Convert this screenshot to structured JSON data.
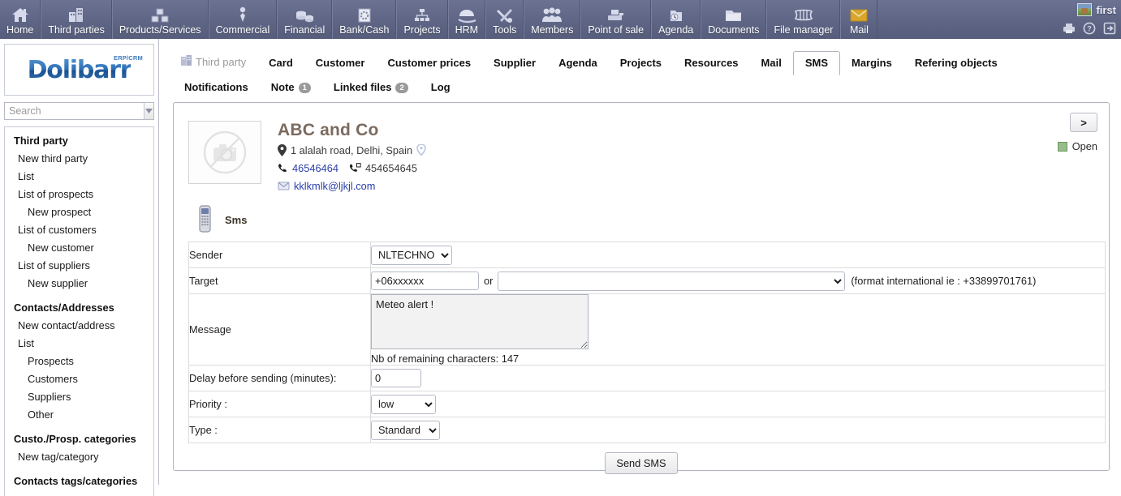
{
  "topmenu": {
    "items": [
      {
        "label": "Home",
        "icon": "home-icon"
      },
      {
        "label": "Third parties",
        "icon": "building-icon"
      },
      {
        "label": "Products/Services",
        "icon": "boxes-icon"
      },
      {
        "label": "Commercial",
        "icon": "tie-icon"
      },
      {
        "label": "Financial",
        "icon": "coins-icon"
      },
      {
        "label": "Bank/Cash",
        "icon": "bank-icon"
      },
      {
        "label": "Projects",
        "icon": "sitemap-icon"
      },
      {
        "label": "HRM",
        "icon": "umbrella-icon"
      },
      {
        "label": "Tools",
        "icon": "tools-icon"
      },
      {
        "label": "Members",
        "icon": "members-icon"
      },
      {
        "label": "Point of sale",
        "icon": "cash-register-icon"
      },
      {
        "label": "Agenda",
        "icon": "clock-folder-icon"
      },
      {
        "label": "Documents",
        "icon": "folder-icon"
      },
      {
        "label": "File manager",
        "icon": "filemanager-icon"
      },
      {
        "label": "Mail",
        "icon": "envelope-icon"
      }
    ],
    "user_name": "first",
    "right_icons": [
      "printer-icon",
      "help-icon",
      "logout-icon"
    ]
  },
  "sidebar": {
    "logo_text": "Dolibarr",
    "logo_sup": "ERP/CRM",
    "search": {
      "placeholder": "Search",
      "value": ""
    },
    "groups": [
      {
        "head": "Third party",
        "items": [
          {
            "label": "New third party",
            "level": 1
          },
          {
            "label": "List",
            "level": 1
          },
          {
            "label": "List of prospects",
            "level": 1
          },
          {
            "label": "New prospect",
            "level": 2
          },
          {
            "label": "List of customers",
            "level": 1
          },
          {
            "label": "New customer",
            "level": 2
          },
          {
            "label": "List of suppliers",
            "level": 1
          },
          {
            "label": "New supplier",
            "level": 2
          }
        ]
      },
      {
        "head": "Contacts/Addresses",
        "items": [
          {
            "label": "New contact/address",
            "level": 1
          },
          {
            "label": "List",
            "level": 1
          },
          {
            "label": "Prospects",
            "level": 2
          },
          {
            "label": "Customers",
            "level": 2
          },
          {
            "label": "Suppliers",
            "level": 2
          },
          {
            "label": "Other",
            "level": 2
          }
        ]
      },
      {
        "head": "Custo./Prosp. categories",
        "items": [
          {
            "label": "New tag/category",
            "level": 1
          }
        ]
      },
      {
        "head": "Contacts tags/categories",
        "items": []
      }
    ]
  },
  "tabs": {
    "object_title": "Third party",
    "row1": [
      {
        "label": "Card",
        "active": false
      },
      {
        "label": "Customer",
        "active": false
      },
      {
        "label": "Customer prices",
        "active": false
      },
      {
        "label": "Supplier",
        "active": false
      },
      {
        "label": "Agenda",
        "active": false
      },
      {
        "label": "Projects",
        "active": false
      },
      {
        "label": "Resources",
        "active": false
      },
      {
        "label": "Mail",
        "active": false
      },
      {
        "label": "SMS",
        "active": true
      },
      {
        "label": "Margins",
        "active": false
      },
      {
        "label": "Refering objects",
        "active": false
      }
    ],
    "row2": [
      {
        "label": "Notifications",
        "badge": ""
      },
      {
        "label": "Note",
        "badge": "1"
      },
      {
        "label": "Linked files",
        "badge": "2"
      },
      {
        "label": "Log",
        "badge": ""
      }
    ]
  },
  "company": {
    "name": "ABC and Co",
    "address": "1 alalah road, Delhi, Spain",
    "phone1": "46546464",
    "phone2": "454654645",
    "email": "kklkmlk@ljkjl.com"
  },
  "status": {
    "next_label": ">",
    "state_label": "Open",
    "state_color": "#96bc8c"
  },
  "sms_form": {
    "section_title": "Sms",
    "labels": {
      "sender": "Sender",
      "target": "Target",
      "message": "Message",
      "delay": "Delay before sending (minutes):",
      "priority": "Priority :",
      "type": "Type :"
    },
    "sender": {
      "value": "NLTECHNO",
      "options": [
        "NLTECHNO"
      ]
    },
    "target": {
      "value": "+06xxxxxx",
      "or_text": "or",
      "list_value": "",
      "list_options": [
        ""
      ],
      "hint": "(format international ie : +33899701761)"
    },
    "message": {
      "value": "Meteo alert !",
      "remaining_text": "Nb of remaining characters: 147"
    },
    "delay": {
      "value": "0"
    },
    "priority": {
      "value": "low",
      "options": [
        "low"
      ]
    },
    "type": {
      "value": "Standard",
      "options": [
        "Standard"
      ]
    },
    "submit_label": "Send SMS"
  }
}
